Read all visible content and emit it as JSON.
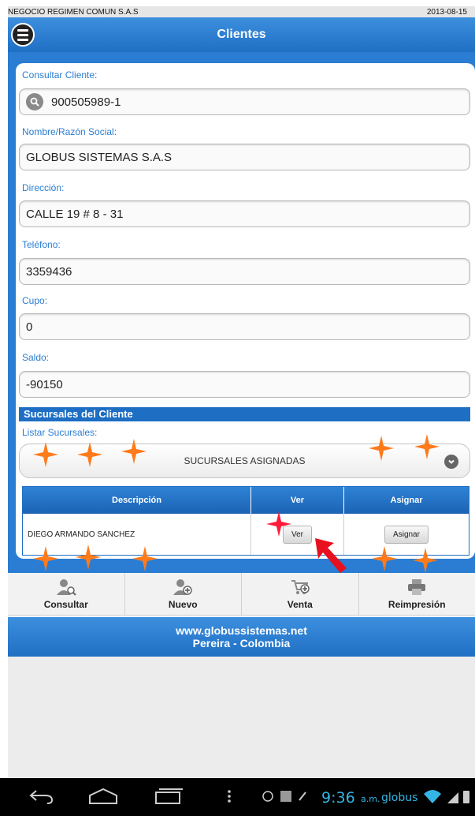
{
  "topbar": {
    "company": "NEGOCIO REGIMEN COMUN S.A.S",
    "date": "2013-08-15"
  },
  "header": {
    "title": "Clientes",
    "menu_icon": "menu-icon"
  },
  "form": {
    "consultar_label": "Consultar Cliente:",
    "consultar_value": "900505989-1",
    "nombre_label": "Nombre/Razón Social:",
    "nombre_value": "GLOBUS SISTEMAS S.A.S",
    "direccion_label": "Dirección:",
    "direccion_value": "CALLE 19 # 8 - 31",
    "telefono_label": "Teléfono:",
    "telefono_value": "3359436",
    "cupo_label": "Cupo:",
    "cupo_value": "0",
    "saldo_label": "Saldo:",
    "saldo_value": "-90150"
  },
  "sucursales": {
    "section_title": "Sucursales del Cliente",
    "listar_label": "Listar Sucursales:",
    "select_value": "SUCURSALES ASIGNADAS",
    "table": {
      "headers": [
        "Descripción",
        "Ver",
        "Asignar"
      ],
      "rows": [
        {
          "descripcion": "DIEGO ARMANDO SANCHEZ",
          "ver": "Ver",
          "asignar": "Asignar"
        }
      ]
    }
  },
  "toolbar": {
    "items": [
      {
        "label": "Consultar",
        "icon": "user-search-icon"
      },
      {
        "label": "Nuevo",
        "icon": "user-add-icon"
      },
      {
        "label": "Venta",
        "icon": "cart-add-icon"
      },
      {
        "label": "Reimpresión",
        "icon": "printer-icon"
      }
    ]
  },
  "footer": {
    "line1": "www.globussistemas.net",
    "line2": "Pereira - Colombia"
  },
  "statusbar": {
    "time": "9:36",
    "ampm": "a.m.",
    "carrier": "globus"
  },
  "colors": {
    "primary": "#2a7dd2",
    "header": "#1f6fc4",
    "label": "#2a7dd2"
  }
}
